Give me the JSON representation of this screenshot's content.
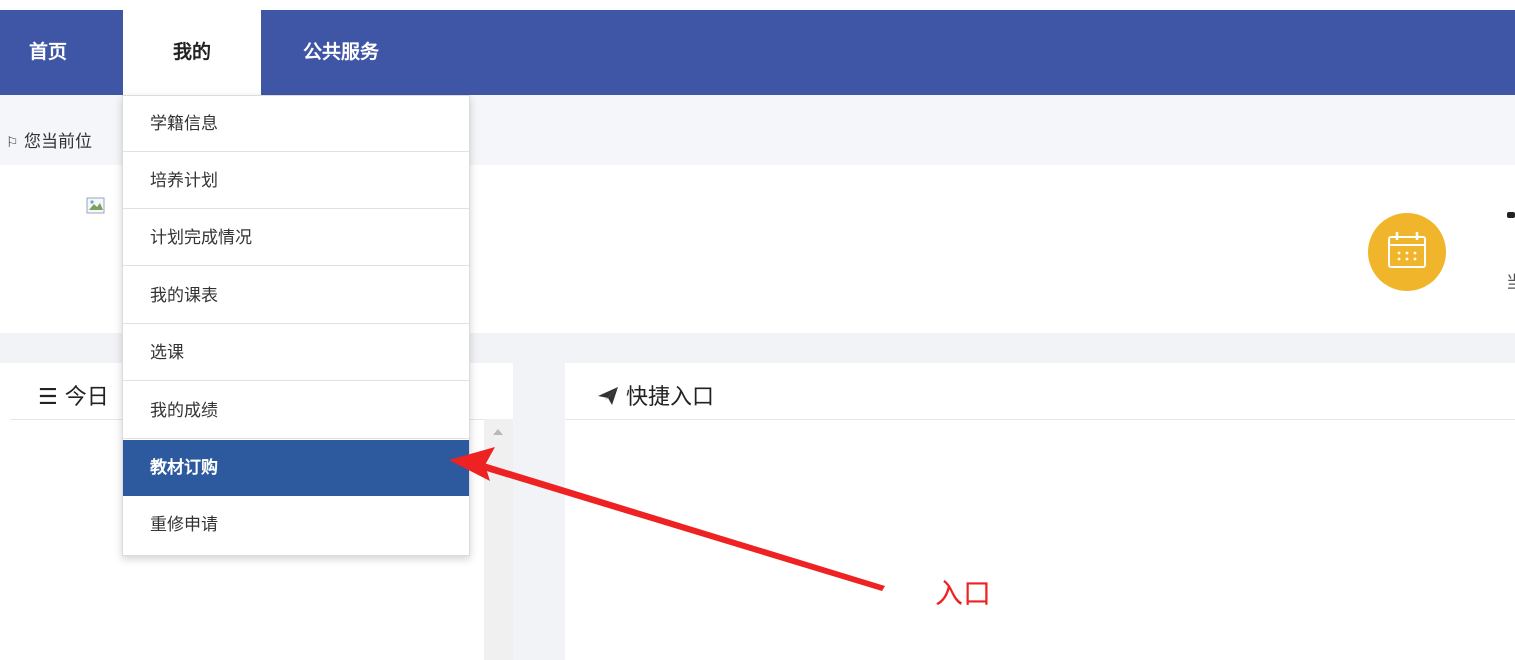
{
  "nav": {
    "items": [
      {
        "label": "首页"
      },
      {
        "label": "我的"
      },
      {
        "label": "公共服务"
      }
    ],
    "active_index": 1
  },
  "breadcrumb": {
    "text": "您当前位"
  },
  "dropdown": {
    "items": [
      {
        "label": "学籍信息"
      },
      {
        "label": "培养计划"
      },
      {
        "label": "计划完成情况"
      },
      {
        "label": "我的课表"
      },
      {
        "label": "选课"
      },
      {
        "label": "我的成绩"
      },
      {
        "label": "教材订购"
      },
      {
        "label": "重修申请"
      }
    ],
    "highlighted_index": 6
  },
  "panels": {
    "left_title": "今日",
    "right_title": "快捷入口"
  },
  "profile": {
    "right_edge_text": "当"
  },
  "annotation": {
    "label": "入口",
    "color": "#ee2222"
  },
  "colors": {
    "navbar": "#3f55a6",
    "dropdown_highlight": "#2d5a9e",
    "calendar_icon": "#f0b52a"
  }
}
